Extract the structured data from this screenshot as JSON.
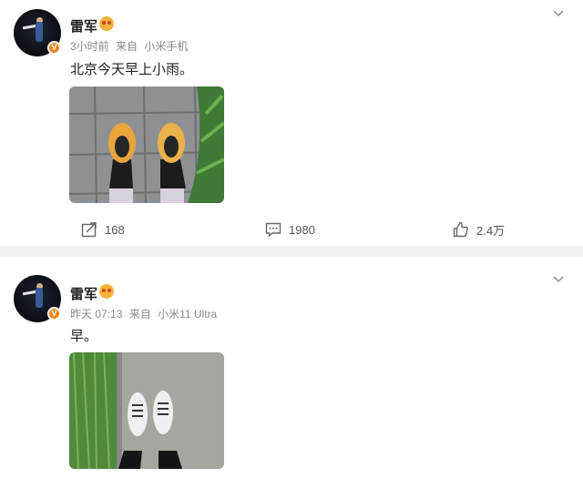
{
  "posts": [
    {
      "author": "雷军",
      "verified_badge": "V",
      "time": "3小时前",
      "source_prefix": "来自",
      "source": "小米手机",
      "text": "北京今天早上小雨。",
      "image_icon": "sneakers-on-wet-tile-photo",
      "actions": {
        "repost": "168",
        "comment": "1980",
        "like": "2.4万"
      }
    },
    {
      "author": "雷军",
      "verified_badge": "V",
      "time": "昨天 07:13",
      "source_prefix": "来自",
      "source": "小米11 Ultra",
      "text": "早。",
      "image_icon": "white-sneakers-on-pavement-photo"
    }
  ],
  "icons": [
    "chevron-down-icon",
    "repost-icon",
    "comment-icon",
    "like-icon",
    "member-badge-icon"
  ],
  "colors": {
    "verified": "#f0831e",
    "divider": "#f2f2f2",
    "meta": "#8a8a8a"
  }
}
